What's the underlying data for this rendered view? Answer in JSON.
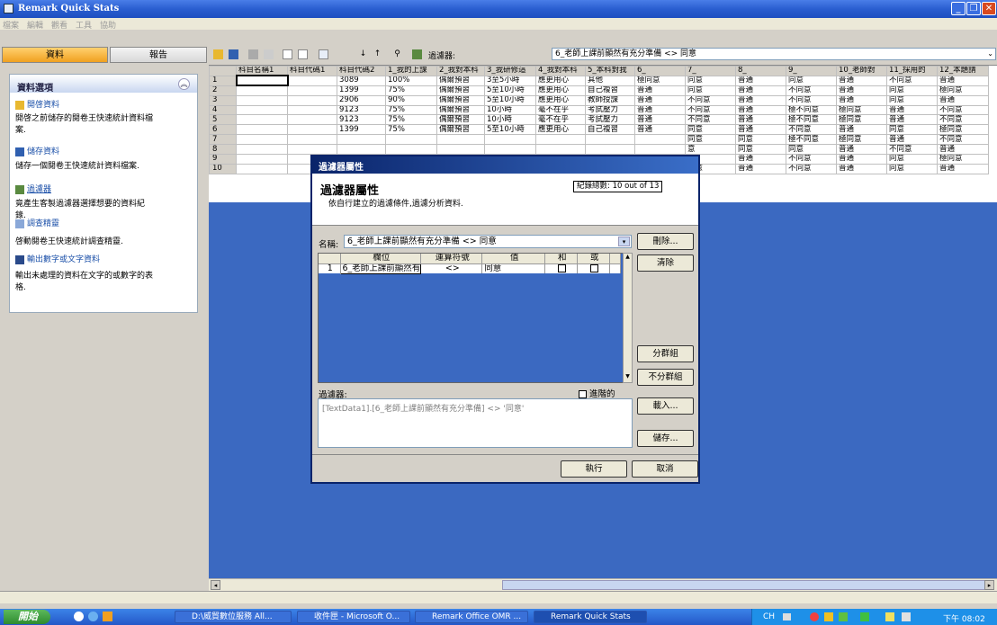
{
  "window": {
    "title": "Remark Quick Stats"
  },
  "menu": [
    "檔案",
    "編輯",
    "觀看",
    "工具",
    "協助"
  ],
  "left_tabs": {
    "data": "資料",
    "report": "報告"
  },
  "panel": {
    "title": "資料選項",
    "items": [
      {
        "link": "開啓資料",
        "desc1": "開啓之前儲存的閱卷王快速統計資料檔",
        "desc2": "案."
      },
      {
        "link": "儲存資料",
        "desc1": "儲存一個閱卷王快速統計資料檔案.",
        "desc2": ""
      },
      {
        "link": "過濾器",
        "desc1": "竟產生客製過濾器選擇想要的資料紀",
        "desc2": "錄."
      },
      {
        "link": "調查精靈",
        "desc1": "啓動閱卷王快速統計調查精靈.",
        "desc2": ""
      },
      {
        "link": "輸出數字或文字資料",
        "desc1": "輸出未處理的資料在文字的或數字的表",
        "desc2": "格."
      }
    ]
  },
  "toolbar": {
    "filter_label": "過濾器:",
    "filter_value": "6_老師上課前顯然有充分準備 <> 同意"
  },
  "grid": {
    "headers": [
      "科目名稱1",
      "科目代碼1",
      "科目代碼2",
      "1_我的上課",
      "2_我對本科",
      "3_我研修這",
      "4_我對本科",
      "5_本科對我",
      "6_",
      "7_",
      "8_",
      "9_",
      "10_老師對",
      "11_採用的",
      "12_本題請"
    ],
    "rows": [
      [
        "",
        "",
        "3089",
        "100%",
        "偶爾預習",
        "3至5小時",
        "應更用心",
        "其他",
        "極同意",
        "同意",
        "普通",
        "同意",
        "普通",
        "不同意",
        "普通"
      ],
      [
        "",
        "",
        "1399",
        "75%",
        "偶爾預習",
        "5至10小時",
        "應更用心",
        "自己複習",
        "普通",
        "同意",
        "普通",
        "不同意",
        "普通",
        "同意",
        "極同意"
      ],
      [
        "",
        "",
        "2906",
        "90%",
        "偶爾預習",
        "5至10小時",
        "應更用心",
        "教師授課",
        "普通",
        "不同意",
        "普通",
        "不同意",
        "普通",
        "同意",
        "普通"
      ],
      [
        "",
        "",
        "9123",
        "75%",
        "偶爾預習",
        "10小時",
        "毫不在乎",
        "考試壓力",
        "普通",
        "不同意",
        "普通",
        "極不同意",
        "極同意",
        "普通",
        "不同意"
      ],
      [
        "",
        "",
        "9123",
        "75%",
        "偶爾預習",
        "10小時",
        "毫不在乎",
        "考試壓力",
        "普通",
        "不同意",
        "普通",
        "極不同意",
        "極同意",
        "普通",
        "不同意"
      ],
      [
        "",
        "",
        "1399",
        "75%",
        "偶爾預習",
        "5至10小時",
        "應更用心",
        "自己複習",
        "普通",
        "同意",
        "普通",
        "不同意",
        "普通",
        "同意",
        "極同意"
      ],
      [
        "",
        "",
        "",
        "",
        "",
        "",
        "",
        "",
        "",
        "同意",
        "同意",
        "極不同意",
        "極同意",
        "普通",
        "不同意"
      ],
      [
        "",
        "",
        "",
        "",
        "",
        "",
        "",
        "",
        "",
        "意",
        "同意",
        "同意",
        "普通",
        "不同意",
        "普通"
      ],
      [
        "",
        "",
        "",
        "",
        "",
        "",
        "",
        "",
        "",
        "意",
        "普通",
        "不同意",
        "普通",
        "同意",
        "極同意"
      ],
      [
        "",
        "",
        "",
        "",
        "",
        "",
        "",
        "",
        "",
        "同意",
        "普通",
        "不同意",
        "普通",
        "同意",
        "普通"
      ]
    ]
  },
  "dialog": {
    "title": "過濾器屬性",
    "heading": "過濾器屬性",
    "subheading": "依自行建立的過濾條件,過濾分析資料.",
    "record_count": "紀錄總數: 10 out of 13",
    "name_label": "名稱:",
    "name_value": "6_老師上課前顯然有充分準備 <> 同意",
    "buttons": {
      "delete": "刪除...",
      "clear": "清除",
      "group": "分群組",
      "ungroup": "不分群組",
      "load": "載入...",
      "save": "儲存...",
      "run": "執行",
      "cancel": "取消"
    },
    "cond_headers": [
      "欄位",
      "運算符號",
      "值",
      "和",
      "或"
    ],
    "cond_row": {
      "num": "1",
      "field": "6_老師上課前顯然有",
      "op": "<>",
      "value": "同意"
    },
    "filter_label": "過濾器:",
    "advanced_label": "進階的",
    "filter_expr": "[TextData1].[6_老師上課前顯然有充分準備] <> '同意'"
  },
  "taskbar": {
    "start": "開始",
    "tasks": [
      "D:\\威貿數位服務 All...",
      "收件匣 - Microsoft O...",
      "Remark Office OMR ...",
      "Remark Quick Stats"
    ],
    "tray_lang": "CH",
    "clock": "下午 08:02"
  }
}
